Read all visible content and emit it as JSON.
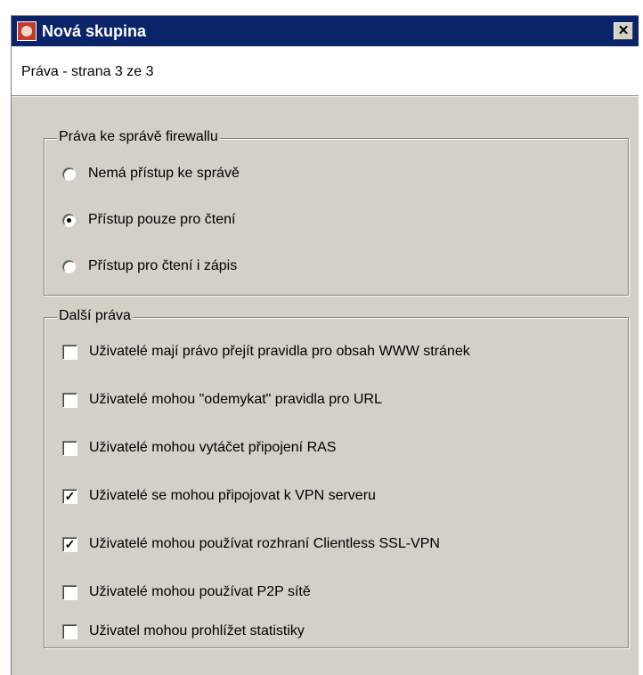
{
  "window": {
    "title": "Nová skupina",
    "close_label": "✕",
    "page_label": "Práva - strana 3 ze 3"
  },
  "firewall_rights": {
    "legend": "Práva ke správě firewallu",
    "options": [
      {
        "label": "Nemá přístup ke správě",
        "selected": false
      },
      {
        "label": "Přístup pouze pro čtení",
        "selected": true
      },
      {
        "label": "Přístup pro čtení i zápis",
        "selected": false
      }
    ]
  },
  "other_rights": {
    "legend": "Další práva",
    "items": [
      {
        "label": "Uživatelé mají právo přejít pravidla pro obsah WWW stránek",
        "checked": false
      },
      {
        "label": "Uživatelé mohou \"odemykat\" pravidla pro URL",
        "checked": false
      },
      {
        "label": "Uživatelé mohou vytáčet připojení RAS",
        "checked": false
      },
      {
        "label": "Uživatelé se mohou připojovat k VPN serveru",
        "checked": true
      },
      {
        "label": "Uživatelé mohou používat rozhraní Clientless SSL-VPN",
        "checked": true
      },
      {
        "label": "Uživatelé mohou používat P2P sítě",
        "checked": false
      },
      {
        "label": "Uživatel mohou prohlížet statistiky",
        "checked": false
      }
    ]
  },
  "colors": {
    "titlebar": "#0a246a",
    "dialog_face": "#d4d0c8"
  }
}
